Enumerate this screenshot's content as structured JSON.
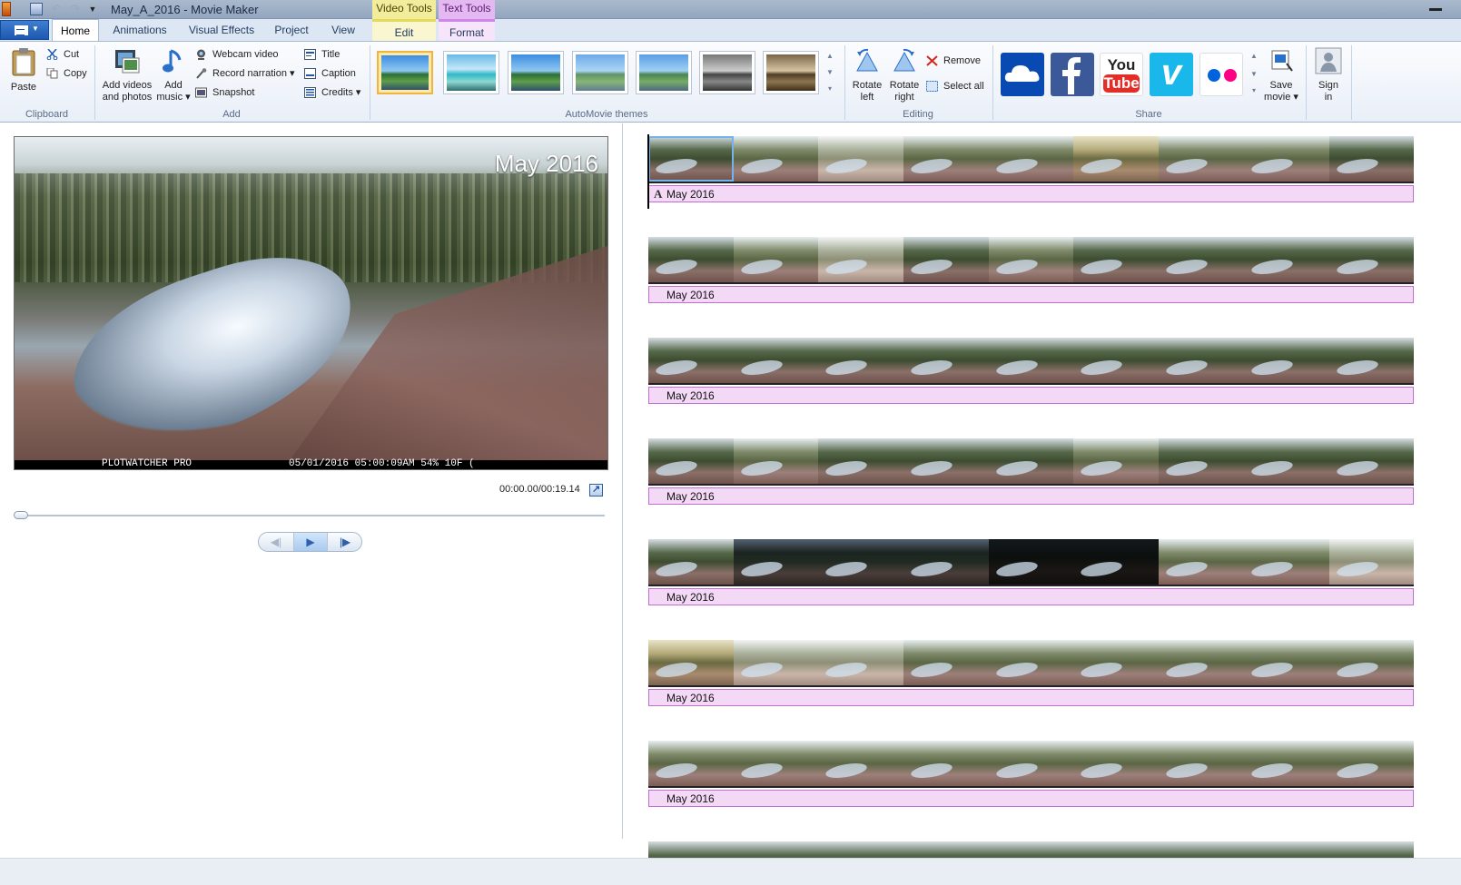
{
  "window": {
    "title": "May_A_2016 - Movie Maker",
    "qat_undo": "↶",
    "qat_redo": "↷",
    "qat_menu": "▼"
  },
  "contextual": {
    "video_tools": "Video Tools",
    "text_tools": "Text Tools"
  },
  "tabs": [
    {
      "label": "Home"
    },
    {
      "label": "Animations"
    },
    {
      "label": "Visual Effects"
    },
    {
      "label": "Project"
    },
    {
      "label": "View"
    },
    {
      "label": "Edit"
    },
    {
      "label": "Format"
    }
  ],
  "ribbon": {
    "clipboard": {
      "label": "Clipboard",
      "paste": "Paste",
      "cut": "Cut",
      "copy": "Copy"
    },
    "add": {
      "label": "Add",
      "add_videos_line1": "Add videos",
      "add_videos_line2": "and photos",
      "add_music_line1": "Add",
      "add_music_line2": "music ▾",
      "webcam": "Webcam video",
      "narration": "Record narration ▾",
      "snapshot": "Snapshot",
      "title": "Title",
      "caption": "Caption",
      "credits": "Credits ▾"
    },
    "themes": {
      "label": "AutoMovie themes",
      "count": 7
    },
    "editing": {
      "label": "Editing",
      "rotate_left_line1": "Rotate",
      "rotate_left_line2": "left",
      "rotate_right_line1": "Rotate",
      "rotate_right_line2": "right",
      "remove": "Remove",
      "select_all": "Select all"
    },
    "share": {
      "label": "Share",
      "youtube_line1": "You",
      "youtube_line2": "Tube",
      "vimeo": "v",
      "save_movie_line1": "Save",
      "save_movie_line2": "movie ▾",
      "sign_in_line1": "Sign",
      "sign_in_line2": "in",
      "colors": {
        "onedrive": "#094ab2",
        "facebook": "#3b5998",
        "youtube": "#e52d27",
        "vimeo": "#1ab7ea",
        "flickr": "#ffffff"
      }
    }
  },
  "preview": {
    "overlay_caption": "May 2016",
    "stamp_left": "PLOTWATCHER PRO",
    "stamp_right": "05/01/2016 05:00:09AM 54% 10F (",
    "timecode": "00:00.00/00:19.14",
    "seek_fraction": 0.0
  },
  "playback": {
    "prev": "◀|",
    "play": "▶",
    "next": "|▶"
  },
  "storyboard": {
    "rows": [
      {
        "caption": "May 2016",
        "frames": [
          "a",
          "b",
          "c",
          "b",
          "b",
          "f",
          "b",
          "b",
          "a"
        ]
      },
      {
        "caption": "May 2016",
        "frames": [
          "a",
          "b",
          "c",
          "a",
          "b",
          "a",
          "a",
          "a",
          "a"
        ]
      },
      {
        "caption": "May 2016",
        "frames": [
          "a",
          "a",
          "a",
          "a",
          "a",
          "a",
          "a",
          "a",
          "a"
        ]
      },
      {
        "caption": "May 2016",
        "frames": [
          "a",
          "b",
          "a",
          "a",
          "a",
          "b",
          "a",
          "a",
          "a"
        ]
      },
      {
        "caption": "May 2016",
        "frames": [
          "a",
          "d",
          "d",
          "d",
          "e",
          "e",
          "b",
          "b",
          "c"
        ]
      },
      {
        "caption": "May 2016",
        "frames": [
          "f",
          "c",
          "c",
          "b",
          "b",
          "b",
          "b",
          "b",
          "b"
        ]
      },
      {
        "caption": "May 2016",
        "frames": [
          "b",
          "b",
          "b",
          "b",
          "b",
          "b",
          "b",
          "b",
          "b"
        ]
      },
      {
        "caption": "",
        "frames": [
          "a",
          "a",
          "a",
          "a",
          "a",
          "a",
          "a",
          "a",
          "a"
        ]
      }
    ]
  }
}
